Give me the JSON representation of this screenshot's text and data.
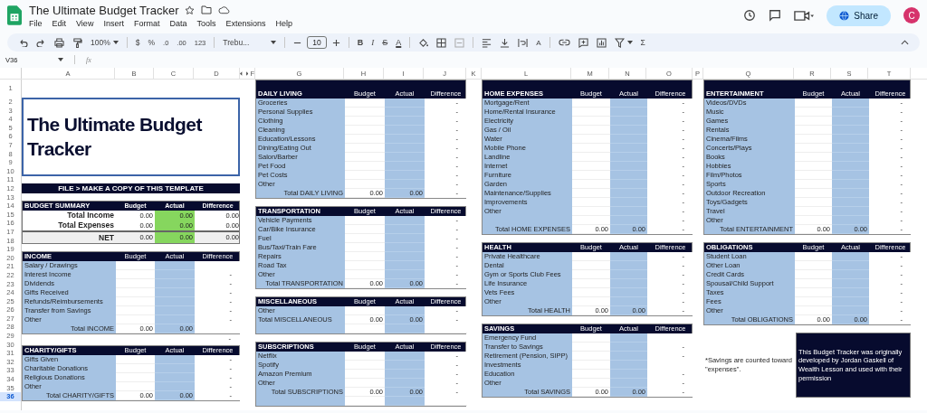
{
  "app": {
    "title": "The Ultimate Budget Tracker",
    "menu": [
      "File",
      "Edit",
      "View",
      "Insert",
      "Format",
      "Data",
      "Tools",
      "Extensions",
      "Help"
    ],
    "share": "Share",
    "avatar": "C"
  },
  "toolbar": {
    "zoom": "100%",
    "currency": "$",
    "percent": "%",
    "decrease_decimals": ".0",
    "increase_decimals": ".00",
    "number_format": "123",
    "font": "Trebu...",
    "font_size": "10",
    "bold": "B",
    "italic": "I",
    "strikethrough": "S",
    "text_color": "A",
    "rotation": "A",
    "functions": "Σ"
  },
  "formula_bar": {
    "cell": "V36",
    "fx": "fx"
  },
  "columns": [
    {
      "label": "A",
      "hidden_before": false
    },
    {
      "label": "B",
      "hidden_before": false
    },
    {
      "label": "C",
      "hidden_before": false
    },
    {
      "label": "D",
      "hidden_before": false
    },
    {
      "label": "F",
      "hidden_before": true
    },
    {
      "label": "G",
      "hidden_before": false
    },
    {
      "label": "H",
      "hidden_before": false
    },
    {
      "label": "I",
      "hidden_before": false
    },
    {
      "label": "J",
      "hidden_before": false
    },
    {
      "label": "K",
      "hidden_before": false
    },
    {
      "label": "L",
      "hidden_before": false
    },
    {
      "label": "M",
      "hidden_before": false
    },
    {
      "label": "N",
      "hidden_before": false
    },
    {
      "label": "O",
      "hidden_before": false
    },
    {
      "label": "P",
      "hidden_before": false
    },
    {
      "label": "Q",
      "hidden_before": false
    },
    {
      "label": "R",
      "hidden_before": false
    },
    {
      "label": "S",
      "hidden_before": false
    },
    {
      "label": "T",
      "hidden_before": false
    }
  ],
  "rows": [
    {
      "label": "1",
      "selected": false
    },
    {
      "label": "2",
      "selected": false
    },
    {
      "label": "3",
      "selected": false
    },
    {
      "label": "4",
      "selected": false
    },
    {
      "label": "5",
      "selected": false
    },
    {
      "label": "6",
      "selected": false
    },
    {
      "label": "7",
      "selected": false
    },
    {
      "label": "8",
      "selected": false
    },
    {
      "label": "9",
      "selected": false
    },
    {
      "label": "10",
      "selected": false
    },
    {
      "label": "11",
      "selected": false
    },
    {
      "label": "12",
      "selected": false
    },
    {
      "label": "13",
      "selected": false
    },
    {
      "label": "14",
      "selected": false
    },
    {
      "label": "15",
      "selected": false
    },
    {
      "label": "16",
      "selected": false
    },
    {
      "label": "17",
      "selected": false
    },
    {
      "label": "18",
      "selected": false
    },
    {
      "label": "19",
      "selected": false
    },
    {
      "label": "20",
      "selected": false
    },
    {
      "label": "21",
      "selected": false
    },
    {
      "label": "22",
      "selected": false
    },
    {
      "label": "23",
      "selected": false
    },
    {
      "label": "24",
      "selected": false
    },
    {
      "label": "25",
      "selected": false
    },
    {
      "label": "26",
      "selected": false
    },
    {
      "label": "27",
      "selected": false
    },
    {
      "label": "28",
      "selected": false
    },
    {
      "label": "29",
      "selected": false
    },
    {
      "label": "30",
      "selected": false
    },
    {
      "label": "31",
      "selected": false
    },
    {
      "label": "32",
      "selected": false
    },
    {
      "label": "33",
      "selected": false
    },
    {
      "label": "34",
      "selected": false
    },
    {
      "label": "35",
      "selected": false
    },
    {
      "label": "36",
      "selected": true
    }
  ],
  "groups": [
    [
      {
        "kind": "title",
        "text": "The Ultimate Budget Tracker"
      },
      {
        "kind": "banner",
        "text": "FILE > MAKE A COPY OF THIS TEMPLATE"
      },
      {
        "kind": "summary",
        "title": "BUDGET SUMMARY",
        "headers": [
          "Budget",
          "Actual",
          "Difference"
        ],
        "rows": [
          {
            "kind": "line",
            "label": "Total Income",
            "budget": "0.00",
            "actual": "0.00",
            "difference": "0.00"
          },
          {
            "kind": "line",
            "label": "Total Expenses",
            "budget": "0.00",
            "actual": "0.00",
            "difference": "0.00"
          },
          {
            "kind": "net",
            "label": "NET",
            "budget": "0.00",
            "actual": "0.00",
            "difference": "0.00"
          }
        ]
      },
      {
        "kind": "table",
        "title": "INCOME",
        "headers": [
          "Budget",
          "Actual",
          "Difference"
        ],
        "items": [
          {
            "label": "Salary / Drawings"
          },
          {
            "label": "Interest Income",
            "difference": "-"
          },
          {
            "label": "Dividends",
            "difference": "-"
          },
          {
            "label": "Gifts Received",
            "difference": "-"
          },
          {
            "label": "Refunds/Reimbursements",
            "difference": "-"
          },
          {
            "label": "Transfer from Savings",
            "difference": "-"
          },
          {
            "label": "Other",
            "difference": "-"
          }
        ],
        "total": {
          "label": "Total INCOME",
          "budget": "0.00",
          "actual": "0.00"
        },
        "trailing_blank_row": false
      },
      {
        "kind": "loose_row",
        "difference": "-"
      },
      {
        "kind": "table",
        "title": "CHARITY/GIFTS",
        "headers": [
          "Budget",
          "Actual",
          "Difference"
        ],
        "items": [
          {
            "label": "Gifts Given",
            "difference": "-"
          },
          {
            "label": "Charitable Donations",
            "difference": "-"
          },
          {
            "label": "Religious Donations",
            "difference": "-"
          },
          {
            "label": "Other",
            "difference": "-"
          }
        ],
        "total": {
          "label": "Total CHARITY/GIFTS",
          "budget": "0.00",
          "actual": "0.00",
          "difference": "-"
        },
        "trailing_blank_row": false
      }
    ],
    [
      {
        "kind": "table",
        "title": "DAILY LIVING",
        "headers": [
          "Budget",
          "Actual",
          "Difference"
        ],
        "items": [
          {
            "label": "Groceries",
            "difference": "-"
          },
          {
            "label": "Personal Supplies",
            "difference": "-"
          },
          {
            "label": "Clothing",
            "difference": "-"
          },
          {
            "label": "Cleaning",
            "difference": "-"
          },
          {
            "label": "Education/Lessons",
            "difference": "-"
          },
          {
            "label": "Dining/Eating Out",
            "difference": "-"
          },
          {
            "label": "Salon/Barber",
            "difference": "-"
          },
          {
            "label": "Pet Food",
            "difference": "-"
          },
          {
            "label": "Pet Costs",
            "difference": "-"
          },
          {
            "label": "Other",
            "difference": "-"
          }
        ],
        "total": {
          "label": "Total DAILY LIVING",
          "budget": "0.00",
          "actual": "0.00",
          "difference": "-"
        },
        "trailing_blank_row": false
      },
      {
        "kind": "table",
        "title": "TRANSPORTATION",
        "headers": [
          "Budget",
          "Actual",
          "Difference"
        ],
        "items": [
          {
            "label": "Vehicle Payments",
            "difference": "-"
          },
          {
            "label": "Car/Bike Insurance",
            "difference": "-"
          },
          {
            "label": "Fuel",
            "difference": "-"
          },
          {
            "label": "Bus/Taxi/Train Fare",
            "difference": "-"
          },
          {
            "label": "Repairs",
            "difference": "-"
          },
          {
            "label": "Road Tax",
            "difference": "-"
          },
          {
            "label": "Other",
            "difference": "-"
          }
        ],
        "total": {
          "label": "Total TRANSPORTATION",
          "budget": "0.00",
          "actual": "0.00",
          "difference": "-"
        },
        "trailing_blank_row": false
      },
      {
        "kind": "table",
        "title": "MISCELLANEOUS",
        "headers": [
          "Budget",
          "Actual",
          "Difference"
        ],
        "items": [
          {
            "label": "Other",
            "difference": "-"
          }
        ],
        "total": {
          "label": "Total MISCELLANEOUS",
          "budget": "0.00",
          "actual": "0.00",
          "difference": "-",
          "align_left": true
        },
        "trailing_blank_row": true
      },
      {
        "kind": "table",
        "title": "SUBSCRIPTIONS",
        "headers": [
          "Budget",
          "Actual",
          "Difference"
        ],
        "items": [
          {
            "label": "Netflix",
            "difference": "-"
          },
          {
            "label": "Spotify",
            "difference": "-"
          },
          {
            "label": "Amazon Premium",
            "difference": "-"
          },
          {
            "label": "Other",
            "difference": "-"
          }
        ],
        "total": {
          "label": "Total SUBSCRIPTIONS",
          "budget": "0.00",
          "actual": "0.00",
          "difference": "-"
        },
        "trailing_blank_row": true
      }
    ],
    [
      {
        "kind": "table",
        "title": "HOME EXPENSES",
        "headers": [
          "Budget",
          "Actual",
          "Difference"
        ],
        "items": [
          {
            "label": "Mortgage/Rent",
            "difference": "-"
          },
          {
            "label": "Home/Rental Insurance",
            "difference": "-"
          },
          {
            "label": "Electricity",
            "difference": "-"
          },
          {
            "label": "Gas / Oil",
            "difference": "-"
          },
          {
            "label": "Water",
            "difference": "-"
          },
          {
            "label": "Mobile Phone",
            "difference": "-"
          },
          {
            "label": "Landline",
            "difference": "-"
          },
          {
            "label": "Internet",
            "difference": "-"
          },
          {
            "label": "Furniture",
            "difference": "-"
          },
          {
            "label": "Garden",
            "difference": "-"
          },
          {
            "label": "Maintenance/Supplies",
            "difference": "-"
          },
          {
            "label": "Improvements",
            "difference": "-"
          },
          {
            "label": "Other",
            "difference": "-"
          },
          {
            "difference": "-"
          }
        ],
        "total": {
          "label": "Total HOME EXPENSES",
          "budget": "0.00",
          "actual": "0.00",
          "difference": "-"
        },
        "trailing_blank_row": false
      },
      {
        "kind": "table",
        "title": "HEALTH",
        "headers": [
          "Budget",
          "Actual",
          "Difference"
        ],
        "items": [
          {
            "label": "Private Healthcare",
            "difference": "-"
          },
          {
            "label": "Dental",
            "difference": "-"
          },
          {
            "label": "Gym or Sports Club Fees",
            "difference": "-"
          },
          {
            "label": "Life Insurance",
            "difference": "-"
          },
          {
            "label": "Vets Fees",
            "difference": "-"
          },
          {
            "label": "Other",
            "difference": "-"
          }
        ],
        "total": {
          "label": "Total HEALTH",
          "budget": "0.00",
          "actual": "0.00",
          "difference": "-"
        },
        "trailing_blank_row": false
      },
      {
        "kind": "table",
        "title": "SAVINGS",
        "headers": [
          "Budget",
          "Actual",
          "Difference"
        ],
        "items": [
          {
            "label": "Emergency Fund"
          },
          {
            "label": "Transfer to Savings",
            "difference": "-"
          },
          {
            "label": "Retirement (Pension, SIPP)",
            "difference": "-"
          },
          {
            "label": "Investments"
          },
          {
            "label": "Education",
            "difference": "-"
          },
          {
            "label": "Other",
            "difference": "-"
          }
        ],
        "total": {
          "label": "Total SAVINGS",
          "budget": "0.00",
          "actual": "0.00",
          "difference": "-"
        },
        "trailing_blank_row": false
      }
    ],
    [
      {
        "kind": "table",
        "title": "ENTERTAINMENT",
        "headers": [
          "Budget",
          "Actual",
          "Difference"
        ],
        "items": [
          {
            "label": "Videos/DVDs",
            "difference": "-"
          },
          {
            "label": "Music",
            "difference": "-"
          },
          {
            "label": "Games",
            "difference": "-"
          },
          {
            "label": "Rentals",
            "difference": "-"
          },
          {
            "label": "Cinema/Films",
            "difference": "-"
          },
          {
            "label": "Concerts/Plays",
            "difference": "-"
          },
          {
            "label": "Books",
            "difference": "-"
          },
          {
            "label": "Hobbies",
            "difference": "-"
          },
          {
            "label": "Film/Photos",
            "difference": "-"
          },
          {
            "label": "Sports",
            "difference": "-"
          },
          {
            "label": "Outdoor Recreation",
            "difference": "-"
          },
          {
            "label": "Toys/Gadgets",
            "difference": "-"
          },
          {
            "label": "Travel",
            "difference": "-"
          },
          {
            "label": "Other",
            "difference": "-"
          }
        ],
        "total": {
          "label": "Total ENTERTAINMENT",
          "budget": "0.00",
          "actual": "0.00",
          "difference": "-"
        },
        "trailing_blank_row": false
      },
      {
        "kind": "table",
        "title": "OBLIGATIONS",
        "headers": [
          "Budget",
          "Actual",
          "Difference"
        ],
        "items": [
          {
            "label": "Student Loan",
            "difference": "-"
          },
          {
            "label": "Other Loan",
            "difference": "-"
          },
          {
            "label": "Credit Cards",
            "difference": "-"
          },
          {
            "label": "Spousal/Child Support",
            "difference": "-"
          },
          {
            "label": "Taxes",
            "difference": "-"
          },
          {
            "label": "Fees",
            "difference": "-"
          },
          {
            "label": "Other",
            "difference": "-"
          }
        ],
        "total": {
          "label": "Total OBLIGATIONS",
          "budget": "0.00",
          "actual": "0.00",
          "difference": "-"
        },
        "trailing_blank_row": false
      },
      {
        "kind": "footer",
        "note": "*Savings are counted toward \"expenses\".",
        "credit": "This Budget Tracker was originally developed by Jordan Gaskell of Wealth Lesson and used with their permission"
      }
    ]
  ]
}
